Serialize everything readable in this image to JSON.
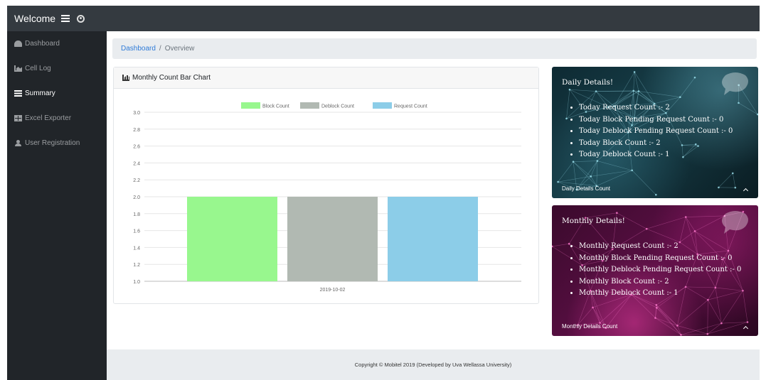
{
  "topbar": {
    "brand": "Welcome",
    "menu_icon": "bars-icon",
    "user_icon": "user-circle-icon"
  },
  "sidebar": {
    "items": [
      {
        "label": "Dashboard",
        "icon": "tachometer-icon",
        "active": false
      },
      {
        "label": "Cell Log",
        "icon": "area-chart-icon",
        "active": false
      },
      {
        "label": "Summary",
        "icon": "list-icon",
        "active": true
      },
      {
        "label": "Excel Exporter",
        "icon": "table-icon",
        "active": false
      },
      {
        "label": "User Registration",
        "icon": "user-icon",
        "active": false
      }
    ]
  },
  "breadcrumb": {
    "link": "Dashboard",
    "separator": "/",
    "current": "Overview"
  },
  "chart_card": {
    "title": "Monthly Count Bar Chart",
    "icon": "bar-chart-icon"
  },
  "chart_data": {
    "type": "bar",
    "categories": [
      "2019-10-02"
    ],
    "series": [
      {
        "name": "Block Count",
        "values": [
          2
        ],
        "color": "#98f78e"
      },
      {
        "name": "Deblock Count",
        "values": [
          2
        ],
        "color": "#b1b9b2"
      },
      {
        "name": "Request Count",
        "values": [
          2
        ],
        "color": "#8ccde8"
      }
    ],
    "ylim": [
      1.0,
      3.0
    ],
    "yticks": [
      "3.0",
      "2.8",
      "2.6",
      "2.4",
      "2.2",
      "2.0",
      "1.8",
      "1.6",
      "1.4",
      "1.2",
      "1.0"
    ],
    "grid": true,
    "legend_position": "top"
  },
  "daily": {
    "title": "Daily Details!",
    "items": [
      "Today Request Count :- 2",
      "Today Block Pending Request Count :- 0",
      "Today Deblock Pending Request Count :- 0",
      "Today Block Count :- 2",
      "Today Deblock Count :- 1"
    ],
    "footer": "Daily Details Count"
  },
  "monthly": {
    "title": "Monthly Details!",
    "items": [
      "Monthly Request Count :- 2",
      "Monthly Block Pending Request Count :- 0",
      "Monthly Deblock Pending Request Count :- 0",
      "Monthly Block Count :- 2",
      "Monthly Deblock Count :- 1"
    ],
    "footer": "Monthly Details Count"
  },
  "footer": {
    "text": "Copyright © Mobitel 2019 (Developed by Uva Wellassa University)"
  }
}
